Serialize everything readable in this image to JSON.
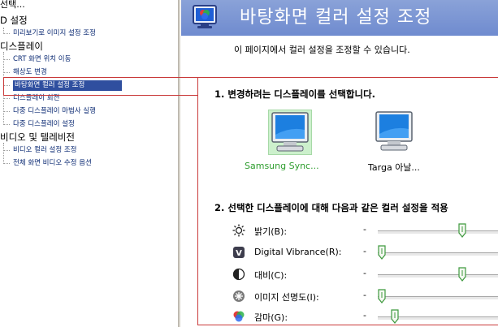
{
  "tree": {
    "header": "선택...",
    "categories": [
      {
        "label": "D 설정",
        "items": [
          "미리보기로 이미지 설정 조정"
        ]
      },
      {
        "label": "디스플레이",
        "items": [
          "CRT 화면 위치 이동",
          "해상도 변경",
          "바탕화면 컬러 설정 조정",
          "디스플레이 회전",
          "다중 디스플레이 마법사 실행",
          "다중 디스플레이 설정"
        ]
      },
      {
        "label": "비디오 및 텔레비전",
        "items": [
          "비디오 컬러 설정 조정",
          "전체 화면 비디오 수정 옵션"
        ]
      }
    ],
    "selected": "바탕화면 컬러 설정 조정"
  },
  "page": {
    "title": "바탕화면 컬러 설정 조정",
    "description": "이 페이지에서 컬러 설정을 조정할 수 있습니다."
  },
  "step1": {
    "heading": "1. 변경하려는 디스플레이를 선택합니다.",
    "displays": [
      {
        "name": "Samsung Sync...",
        "selected": true
      },
      {
        "name": "Targa 아날...",
        "selected": false
      }
    ]
  },
  "step2": {
    "heading": "2. 선택한 디스플레이에 대해 다음과 같은 컬러 설정을 적용",
    "sliders": [
      {
        "label": "밝기(B):",
        "icon": "sun-icon",
        "minus": "-",
        "value": 0.65
      },
      {
        "label": "Digital Vibrance(R):",
        "icon": "vibrance-icon",
        "minus": "-",
        "value": 0.03
      },
      {
        "label": "대비(C):",
        "icon": "contrast-icon",
        "minus": "-",
        "value": 0.65
      },
      {
        "label": "이미지 선명도(I):",
        "icon": "sharpness-icon",
        "minus": "-",
        "value": 0.03
      },
      {
        "label": "감마(G):",
        "icon": "gamma-icon",
        "minus": "-",
        "value": 0.13
      }
    ]
  },
  "colors": {
    "header_band": "#7a94d3",
    "selection_bg": "#2f4f9f",
    "callout": "#c93a3a",
    "selected_display_text": "#2d9d2d",
    "thumb": "#3f9a3f"
  }
}
